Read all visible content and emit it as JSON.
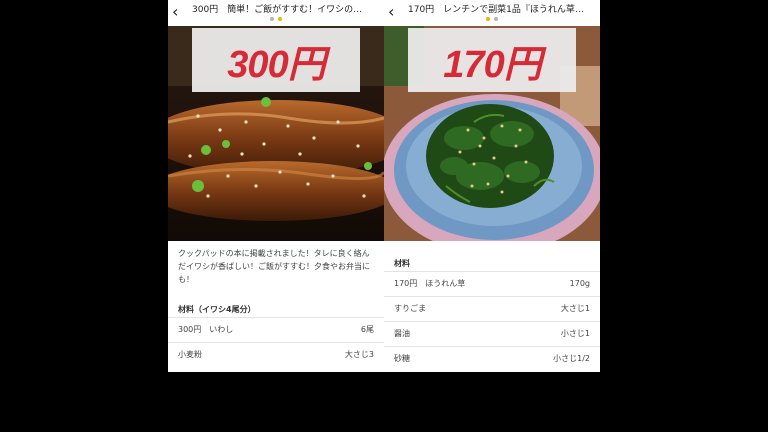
{
  "left": {
    "nav_title": "300円　簡単！ご飯がすすむ！イワシの…",
    "price_overlay": "300円",
    "description": "クックパッドの本に掲載されました！タレに良く絡んだイワシが香ばしい！ご飯がすすむ！夕食やお弁当にも！",
    "ingredients_title": "材料（イワシ4尾分）",
    "ingredients": [
      {
        "name": "300円　いわし",
        "qty": "6尾"
      },
      {
        "name": "小麦粉",
        "qty": "大さじ3"
      }
    ],
    "page_indicator": {
      "count": 2,
      "active": 1
    }
  },
  "right": {
    "nav_title": "170円　レンチンで副菜1品『ほうれん草…",
    "price_overlay": "170円",
    "ingredients_title": "材料",
    "ingredients": [
      {
        "name": "170円　ほうれん草",
        "qty": "170g"
      },
      {
        "name": "すりごま",
        "qty": "大さじ1"
      },
      {
        "name": "醤油",
        "qty": "小さじ1"
      },
      {
        "name": "砂糖",
        "qty": "小さじ1/2"
      }
    ],
    "page_indicator": {
      "count": 2,
      "active": 0
    }
  },
  "icons": {
    "back": "back-chevron-icon"
  },
  "colors": {
    "background": "#000000",
    "price_text": "#d62b36",
    "dot_active": "#f0b400",
    "dot_inactive": "#b5b5b5",
    "text": "#444444"
  }
}
